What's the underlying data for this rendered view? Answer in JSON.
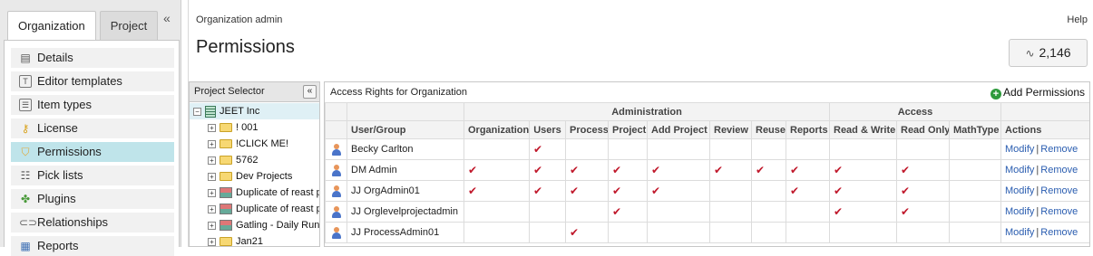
{
  "sidebar": {
    "tabs": [
      "Organization",
      "Project"
    ],
    "collapse_glyph": "«",
    "items": [
      {
        "label": "Details",
        "icon": "details-icon",
        "glyph": "▤",
        "style": ""
      },
      {
        "label": "Editor templates",
        "icon": "template-icon",
        "glyph": "T",
        "style": "box"
      },
      {
        "label": "Item types",
        "icon": "item-types-icon",
        "glyph": "☰",
        "style": "box"
      },
      {
        "label": "License",
        "icon": "key-icon",
        "glyph": "⚷",
        "style": "key"
      },
      {
        "label": "Permissions",
        "icon": "shield-icon",
        "glyph": "⛉",
        "style": "shield"
      },
      {
        "label": "Pick lists",
        "icon": "list-icon",
        "glyph": "☷",
        "style": ""
      },
      {
        "label": "Plugins",
        "icon": "plugin-icon",
        "glyph": "✤",
        "style": "plug"
      },
      {
        "label": "Relationships",
        "icon": "link-icon",
        "glyph": "⊂⊃",
        "style": "link"
      },
      {
        "label": "Reports",
        "icon": "reports-icon",
        "glyph": "▦",
        "style": "rep"
      }
    ],
    "selected_index": 4
  },
  "header": {
    "breadcrumb": "Organization admin",
    "help": "Help",
    "title": "Permissions",
    "counter": "2,146",
    "counter_icon": "pulse-icon"
  },
  "selector": {
    "title": "Project Selector",
    "collapse_glyph": "«",
    "root": "JEET Inc",
    "items": [
      {
        "label": "! 001",
        "type": "folder"
      },
      {
        "label": "!CLICK ME!",
        "type": "folder"
      },
      {
        "label": "5762",
        "type": "folder"
      },
      {
        "label": "Dev Projects",
        "type": "folder"
      },
      {
        "label": "Duplicate of reast p",
        "type": "project"
      },
      {
        "label": "Duplicate of reast p",
        "type": "project"
      },
      {
        "label": "Gatling - Daily Run",
        "type": "project"
      },
      {
        "label": "Jan21",
        "type": "folder"
      }
    ]
  },
  "access": {
    "title": "Access Rights for Organization",
    "add_label": "Add Permissions",
    "group_admin": "Administration",
    "group_access": "Access",
    "columns": [
      "User/Group",
      "Organization",
      "Users",
      "Process",
      "Project",
      "Add Project",
      "Review",
      "Reuse",
      "Reports",
      "Read & Write",
      "Read Only",
      "MathType",
      "Actions"
    ],
    "check_glyph": "✔",
    "modify": "Modify",
    "separator": "|",
    "remove": "Remove",
    "rows": [
      {
        "name": "Becky Carlton",
        "perms": [
          false,
          true,
          false,
          false,
          false,
          false,
          false,
          false,
          false,
          false,
          false
        ]
      },
      {
        "name": "DM Admin",
        "perms": [
          true,
          true,
          true,
          true,
          true,
          true,
          true,
          true,
          true,
          true,
          false
        ]
      },
      {
        "name": "JJ OrgAdmin01",
        "perms": [
          true,
          true,
          true,
          true,
          true,
          false,
          false,
          true,
          true,
          true,
          false
        ]
      },
      {
        "name": "JJ Orglevelprojectadmin",
        "perms": [
          false,
          false,
          false,
          true,
          false,
          false,
          false,
          false,
          true,
          true,
          false
        ]
      },
      {
        "name": "JJ ProcessAdmin01",
        "perms": [
          false,
          false,
          true,
          false,
          false,
          false,
          false,
          false,
          false,
          false,
          false
        ]
      }
    ]
  }
}
